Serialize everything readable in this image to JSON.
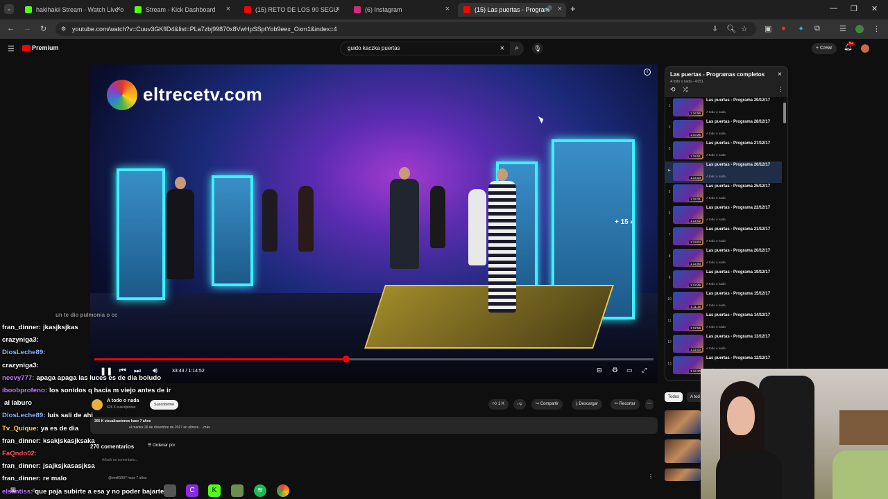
{
  "browser": {
    "tabs": [
      {
        "label": "hakihakii Stream - Watch Live o",
        "color": "#53fc18"
      },
      {
        "label": "Stream - Kick Dashboard",
        "color": "#53fc18"
      },
      {
        "label": "(15) RETO DE LOS 90 SEGUNDO",
        "color": "#ff0000"
      },
      {
        "label": "(6) Instagram",
        "color": "#d62976"
      },
      {
        "label": "(15) Las puertas - Programa",
        "color": "#ff0000"
      }
    ],
    "url": "youtube.com/watch?v=Cuuv3GKflD4&list=PLa7zbj99870x8VwHpSSptYob9eex_Oxm1&index=4"
  },
  "youtube": {
    "logo": "Premium",
    "search_query": "guido kaczka puertas",
    "create_label": "Crear",
    "notif_count": "9+"
  },
  "video": {
    "watermark": "eltrecetv.com",
    "skip_label": "+ 15",
    "time_display": "33:43 / 1:14:52",
    "progress_fraction": 0.45
  },
  "below": {
    "channel_name": "A todo o nada",
    "subscribers": "626 K suscriptores",
    "subscribe_label": "Suscribirme",
    "likes": "1 K",
    "share_label": "Compartir",
    "download_label": "Descargar",
    "clip_label": "Recortar",
    "desc_stats": "205 K visualizaciones  hace 7 años",
    "desc_text": "el martes 26 de diciembre de 2017 en eltrece. ...más",
    "comments_count": "270 comentarios",
    "sort_label": "Ordenar por",
    "add_comment": "Añadir un comentario...",
    "first_commenter": "@emilf1907  hace 7 años"
  },
  "playlist": {
    "title": "Las puertas - Programas completos",
    "subtitle": "A todo o nada - 4/251",
    "items": [
      {
        "index": "1",
        "name": "Las puertas - Programa 29/12/17",
        "channel": "A todo o nada",
        "duration": "1:16:56"
      },
      {
        "index": "2",
        "name": "Las puertas - Programa 28/12/17",
        "channel": "A todo o nada",
        "duration": "1:10:25"
      },
      {
        "index": "3",
        "name": "Las puertas - Programa 27/12/17",
        "channel": "A todo o nada",
        "duration": "1:15:51"
      },
      {
        "index": "▶",
        "name": "Las puertas - Programa 26/12/17",
        "channel": "A todo o nada",
        "duration": "1:14:53"
      },
      {
        "index": "5",
        "name": "Las puertas - Programa 25/12/17",
        "channel": "A todo o nada",
        "duration": "1:15:21"
      },
      {
        "index": "6",
        "name": "Las puertas - Programa 22/12/17",
        "channel": "A todo o nada",
        "duration": "1:12:02"
      },
      {
        "index": "7",
        "name": "Las puertas - Programa 21/12/17",
        "channel": "A todo o nada",
        "duration": "1:13:04"
      },
      {
        "index": "8",
        "name": "Las puertas - Programa 20/12/17",
        "channel": "A todo o nada",
        "duration": "1:12:50"
      },
      {
        "index": "9",
        "name": "Las puertas - Programa 19/12/17",
        "channel": "A todo o nada",
        "duration": "1:13:49"
      },
      {
        "index": "10",
        "name": "Las puertas - Programa 15/12/17",
        "channel": "A todo o nada",
        "duration": "1:11:16"
      },
      {
        "index": "11",
        "name": "Las puertas - Programa 14/12/17",
        "channel": "A todo o nada",
        "duration": "1:12:56"
      },
      {
        "index": "12",
        "name": "Las puertas - Programa 13/12/17",
        "channel": "A todo o nada",
        "duration": "1:12:03"
      },
      {
        "index": "13",
        "name": "Las puertas - Programa 12/12/17",
        "channel": "A todo o nada",
        "duration": "1:16:20"
      }
    ]
  },
  "chips": [
    "Todos",
    "A tod"
  ],
  "chat": [
    {
      "user": "fran_dinner:",
      "msg": "jkasjksjkas",
      "color": "#ffffff"
    },
    {
      "user": "crazyniga3:",
      "msg": "",
      "color": "#ffffff"
    },
    {
      "user": "DiosLeche89:",
      "msg": "",
      "color": "#8fb8ff"
    },
    {
      "user": "crazyniga3:",
      "msg": "",
      "color": "#ffffff"
    },
    {
      "user": "neevy777:",
      "msg": "apaga apaga las luces es de dia boludo",
      "color": "#c07cff"
    },
    {
      "user": "iboobprofeno:",
      "msg": "los sonidos q hacia m viejo antes de ir",
      "color": "#c07cff"
    },
    {
      "user": "",
      "msg": "al laburo",
      "color": "#ffffff"
    },
    {
      "user": "DiosLeche89:",
      "msg": "luis sali de ahi",
      "color": "#8fb8ff"
    },
    {
      "user": "Tv_Quique:",
      "msg": "ya es de dia",
      "color": "#ffd84d"
    },
    {
      "user": "fran_dinner:",
      "msg": "ksakjskasjksaka",
      "color": "#ffffff"
    },
    {
      "user": "FaQndo02:",
      "msg": "",
      "color": "#ff5a5a"
    },
    {
      "user": "fran_dinner:",
      "msg": "jsajksjkasasjksa",
      "color": "#ffffff"
    },
    {
      "user": "fran_dinner:",
      "msg": "re malo",
      "color": "#ffffff"
    },
    {
      "user": "elsantiss:",
      "msg": "que paja subirte a esa y no poder bajarte",
      "color": "#c07cff"
    }
  ],
  "chat_partial": "un te dio pulmonia o cc"
}
